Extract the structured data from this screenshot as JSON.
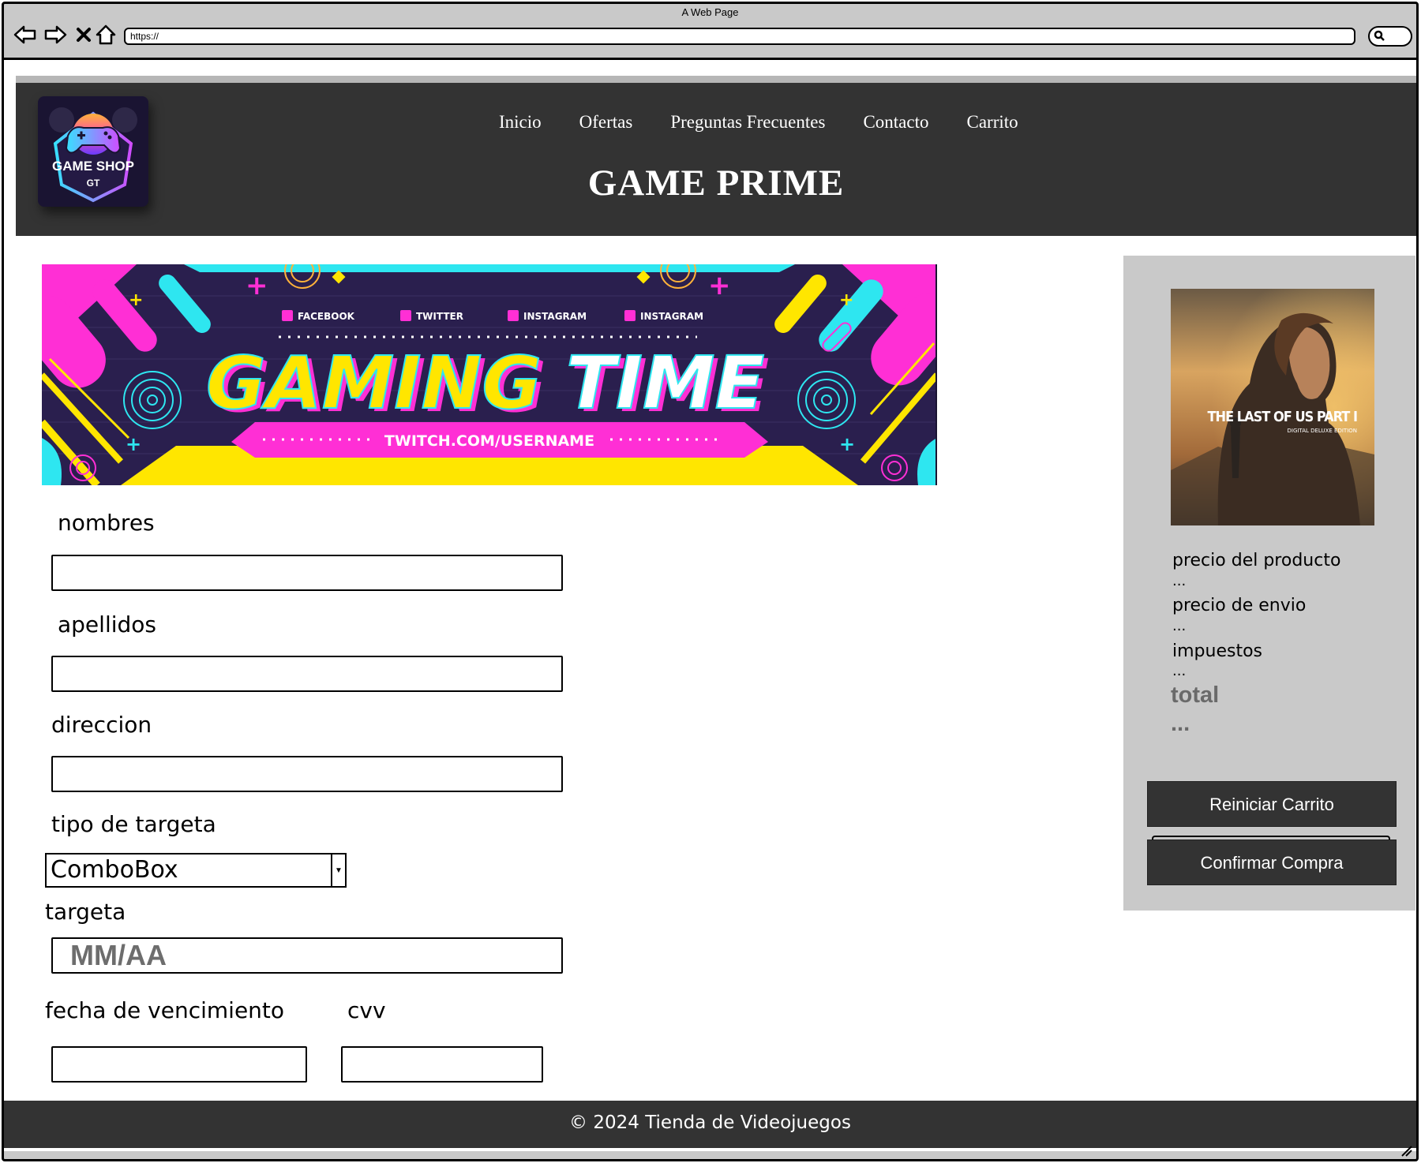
{
  "window": {
    "title": "A Web Page",
    "url": "https://"
  },
  "header": {
    "logo": {
      "line1": "GAME SHOP",
      "line2": "GT"
    },
    "nav": [
      "Inicio",
      "Ofertas",
      "Preguntas Frecuentes",
      "Contacto",
      "Carrito"
    ],
    "title": "GAME PRIME"
  },
  "banner": {
    "socials": [
      "FACEBOOK",
      "TWITTER",
      "INSTAGRAM",
      "INSTAGRAM"
    ],
    "headline_part1": "GAMING",
    "headline_part2": "TIME",
    "link": "TWITCH.COM/USERNAME"
  },
  "form": {
    "nombres_label": "nombres",
    "apellidos_label": "apellidos",
    "direccion_label": "direccion",
    "tipo_label": "tipo de targeta",
    "tipo_value": "ComboBox",
    "targeta_label": "targeta",
    "targeta_placeholder": "MM/AA",
    "vencimiento_label": "fecha de vencimiento",
    "cvv_label": "cvv"
  },
  "cart": {
    "product_image_text": {
      "title": "THE LAST OF US PART I",
      "subtitle": "DIGITAL DELUXE EDITION"
    },
    "precio_producto_label": "precio del producto",
    "precio_producto_value": "...",
    "precio_envio_label": "precio de envio",
    "precio_envio_value": "...",
    "impuestos_label": "impuestos",
    "impuestos_value": "...",
    "total_label": "total",
    "total_value": "...",
    "reset_button": "Reiniciar Carrito",
    "confirm_button": "Confirmar Compra"
  },
  "footer": {
    "text": "© 2024 Tienda de Videojuegos"
  },
  "colors": {
    "header_bg": "#333333",
    "panel_bg": "#c9c9c9",
    "banner_pink": "#ff2fd5",
    "banner_cyan": "#2ee6f0",
    "banner_yellow": "#ffe600",
    "banner_dark": "#2a1f4e"
  }
}
